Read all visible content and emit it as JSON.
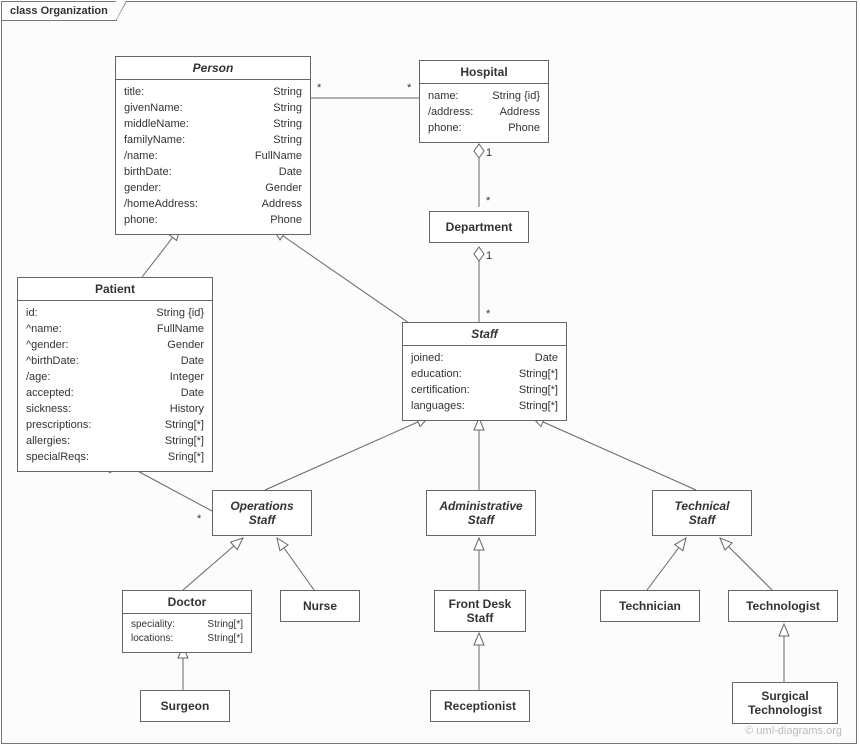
{
  "frame_label": "class Organization",
  "watermark": "© uml-diagrams.org",
  "classes": {
    "person": {
      "name": "Person",
      "attrs": [
        {
          "name": "title:",
          "type": "String"
        },
        {
          "name": "givenName:",
          "type": "String"
        },
        {
          "name": "middleName:",
          "type": "String"
        },
        {
          "name": "familyName:",
          "type": "String"
        },
        {
          "name": "/name:",
          "type": "FullName"
        },
        {
          "name": "birthDate:",
          "type": "Date"
        },
        {
          "name": "gender:",
          "type": "Gender"
        },
        {
          "name": "/homeAddress:",
          "type": "Address"
        },
        {
          "name": "phone:",
          "type": "Phone"
        }
      ]
    },
    "hospital": {
      "name": "Hospital",
      "attrs": [
        {
          "name": "name:",
          "type": "String {id}"
        },
        {
          "name": "/address:",
          "type": "Address"
        },
        {
          "name": "phone:",
          "type": "Phone"
        }
      ]
    },
    "department": {
      "name": "Department"
    },
    "patient": {
      "name": "Patient",
      "attrs": [
        {
          "name": "id:",
          "type": "String {id}"
        },
        {
          "name": "^name:",
          "type": "FullName"
        },
        {
          "name": "^gender:",
          "type": "Gender"
        },
        {
          "name": "^birthDate:",
          "type": "Date"
        },
        {
          "name": "/age:",
          "type": "Integer"
        },
        {
          "name": "accepted:",
          "type": "Date"
        },
        {
          "name": "sickness:",
          "type": "History"
        },
        {
          "name": "prescriptions:",
          "type": "String[*]"
        },
        {
          "name": "allergies:",
          "type": "String[*]"
        },
        {
          "name": "specialReqs:",
          "type": "Sring[*]"
        }
      ]
    },
    "staff": {
      "name": "Staff",
      "attrs": [
        {
          "name": "joined:",
          "type": "Date"
        },
        {
          "name": "education:",
          "type": "String[*]"
        },
        {
          "name": "certification:",
          "type": "String[*]"
        },
        {
          "name": "languages:",
          "type": "String[*]"
        }
      ]
    },
    "opsStaff": {
      "name": "Operations\nStaff"
    },
    "adminStaff": {
      "name": "Administrative\nStaff"
    },
    "techStaff": {
      "name": "Technical\nStaff"
    },
    "doctor": {
      "name": "Doctor",
      "attrs": [
        {
          "name": "speciality:",
          "type": "String[*]"
        },
        {
          "name": "locations:",
          "type": "String[*]"
        }
      ]
    },
    "nurse": {
      "name": "Nurse"
    },
    "frontDesk": {
      "name": "Front Desk\nStaff"
    },
    "technician": {
      "name": "Technician"
    },
    "technologist": {
      "name": "Technologist"
    },
    "surgeon": {
      "name": "Surgeon"
    },
    "receptionist": {
      "name": "Receptionist"
    },
    "surgTech": {
      "name": "Surgical\nTechnologist"
    }
  },
  "labels": {
    "star": "*",
    "one": "1"
  }
}
